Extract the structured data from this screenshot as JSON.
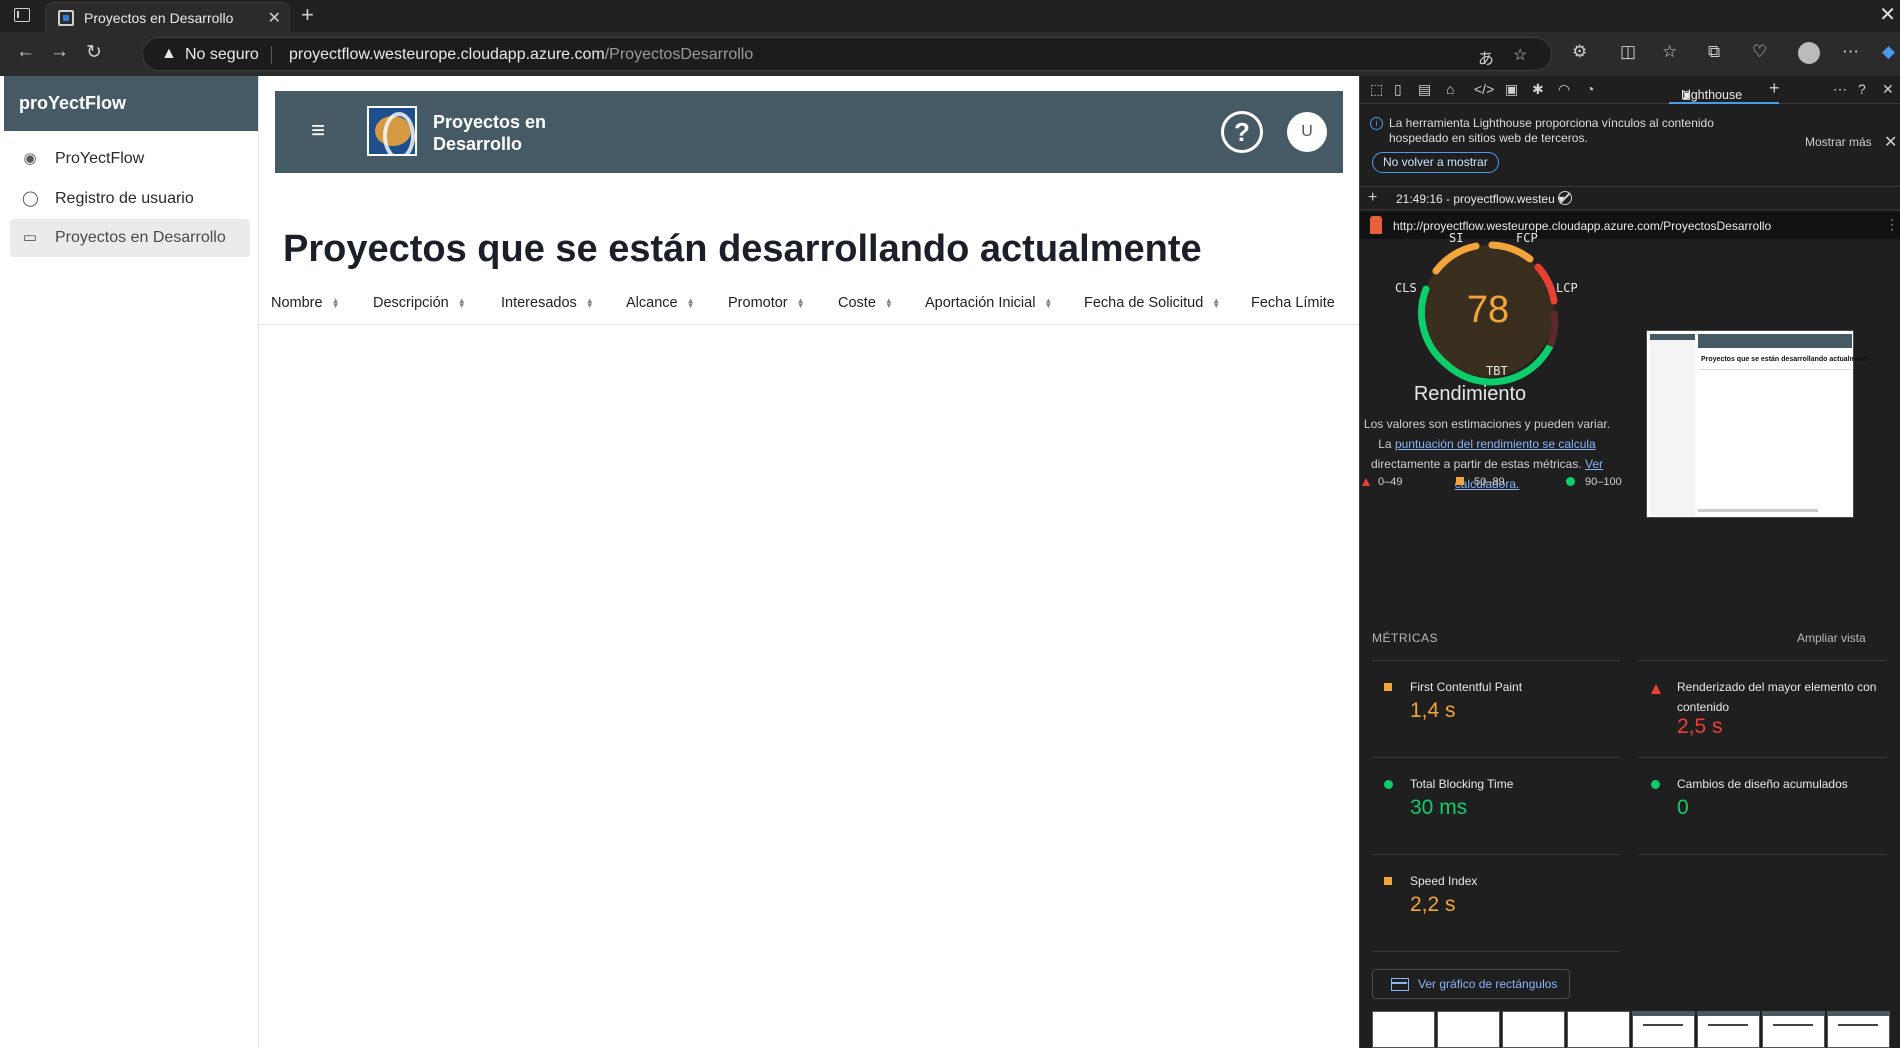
{
  "browser": {
    "tab_title": "Proyectos en Desarrollo",
    "security_label": "No seguro",
    "url_host": "proyectflow.westeurope.cloudapp.azure.com",
    "url_path": "/ProyectosDesarrollo"
  },
  "sidenav": {
    "brand": "proYectFlow",
    "items": [
      {
        "label": "ProYectFlow",
        "icon": "globe-icon"
      },
      {
        "label": "Registro de usuario",
        "icon": "user-icon"
      },
      {
        "label": "Proyectos en Desarrollo",
        "icon": "archive-icon",
        "active": true
      }
    ]
  },
  "toolbar": {
    "title": "Proyectos en Desarrollo",
    "help_label": "?",
    "avatar_initial": "U"
  },
  "page": {
    "heading": "Proyectos que se están desarrollando actualmente",
    "columns": [
      "Nombre",
      "Descripción",
      "Interesados",
      "Alcance",
      "Promotor",
      "Coste",
      "Aportación Inicial",
      "Fecha de Solicitud",
      "Fecha Límite"
    ]
  },
  "devtools": {
    "active_tab": "Lighthouse",
    "info_text": "La herramienta Lighthouse proporciona vínculos al contenido hospedado en sitios web de terceros.",
    "show_more": "Mostrar más",
    "dont_show": "No volver a mostrar",
    "report_selector": "21:49:16 - proyectflow.westeu",
    "report_url": "http://proyectflow.westeurope.cloudapp.azure.com/ProyectosDesarrollo",
    "gauge": {
      "score": "78",
      "labels": {
        "si": "SI",
        "fcp": "FCP",
        "lcp": "LCP",
        "tbt": "TBT",
        "cls": "CLS"
      },
      "title": "Rendimiento",
      "desc_prefix": "Los valores son estimaciones y pueden variar. La ",
      "desc_link": "puntuación del rendimiento se calcula",
      "desc_middle": " directamente a partir de estas métricas. ",
      "desc_link2": "Ver calculadora."
    },
    "legend": {
      "fail": "0–49",
      "average": "50–89",
      "pass": "90–100"
    },
    "screenshot_heading": "Proyectos que se están desarrollando actualmente",
    "metrics_header": "MÉTRICAS",
    "expand_view": "Ampliar vista",
    "metrics": [
      {
        "name": "First Contentful Paint",
        "value": "1,4 s",
        "rating": "average"
      },
      {
        "name": "Renderizado del mayor elemento con contenido",
        "value": "2,5 s",
        "rating": "fail"
      },
      {
        "name": "Total Blocking Time",
        "value": "30 ms",
        "rating": "pass"
      },
      {
        "name": "Cambios de diseño acumulados",
        "value": "0",
        "rating": "pass"
      },
      {
        "name": "Speed Index",
        "value": "2,2 s",
        "rating": "average"
      }
    ],
    "treemap_button": "Ver gráfico de rectángulos",
    "colors": {
      "pass": "#0cce6b",
      "average": "#f3a53a",
      "fail": "#e84134",
      "accent": "#455a64"
    }
  }
}
